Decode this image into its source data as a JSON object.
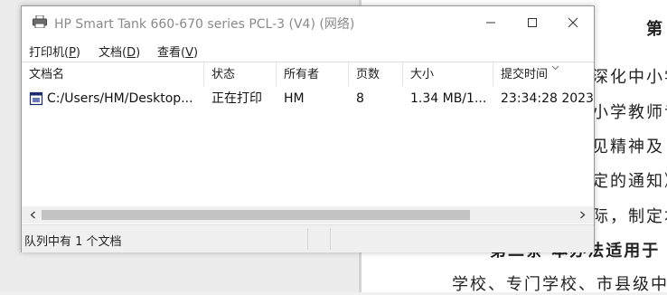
{
  "window": {
    "title": "HP Smart Tank 660-670 series PCL-3 (V4) (网络)"
  },
  "menu": [
    {
      "label": "打印机(P)",
      "pre": "打印机(",
      "key": "P",
      "post": ")"
    },
    {
      "label": "文档(D)",
      "pre": "文档(",
      "key": "D",
      "post": ")"
    },
    {
      "label": "查看(V)",
      "pre": "查看(",
      "key": "V",
      "post": ")"
    }
  ],
  "columns": {
    "document_name": "文档名",
    "status": "状态",
    "owner": "所有者",
    "pages": "页数",
    "size": "大小",
    "submitted": "提交时间"
  },
  "jobs": [
    {
      "document_name": "C:/Users/HM/Desktop...",
      "status": "正在打印",
      "owner": "HM",
      "pages": "8",
      "size": "1.34 MB/1...",
      "submitted": "23:34:28  2023"
    }
  ],
  "status_bar": {
    "text": "队列中有 1 个文档"
  },
  "scrollbar": {
    "position_fraction": 0.0,
    "visible_fraction": 0.8
  },
  "background_document": {
    "lines": [
      "第",
      "深化中小学",
      "小学教师专",
      "见精神及《",
      "定的通知》",
      "际，制定本",
      "第二条  本办法适用于",
      "学校、专门学校、市县级中"
    ]
  },
  "colors": {
    "title_text": "#8a8a8a",
    "window_bg": "#ffffff",
    "statusbar_bg": "#f0f0f0",
    "scroll_thumb": "#c3c3c3"
  }
}
